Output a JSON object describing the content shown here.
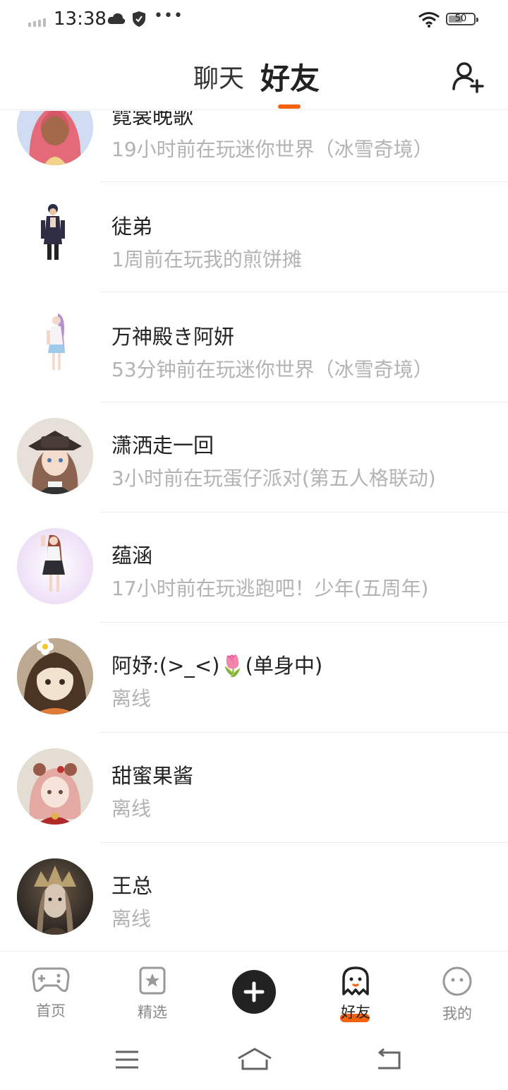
{
  "status_bar": {
    "time": "13:38",
    "battery": "50"
  },
  "header": {
    "tabs": [
      "聊天",
      "好友"
    ],
    "active_tab": "好友"
  },
  "friends": [
    {
      "name": "霓裳晚歌",
      "status": "19小时前在玩迷你世界（冰雪奇境）"
    },
    {
      "name": "徒弟",
      "status": "1周前在玩我的煎饼摊"
    },
    {
      "name": "万神殿き阿妍",
      "status": "53分钟前在玩迷你世界（冰雪奇境）"
    },
    {
      "name": "潇洒走一回",
      "status": "3小时前在玩蛋仔派对(第五人格联动)"
    },
    {
      "name": "蕴涵",
      "status": "17小时前在玩逃跑吧！少年(五周年)"
    },
    {
      "name": "阿妤:(>_<)🌷(单身中)",
      "status": "离线"
    },
    {
      "name": "甜蜜果酱",
      "status": "离线"
    },
    {
      "name": "王总",
      "status": "离线"
    }
  ],
  "nav": {
    "home": "首页",
    "featured": "精选",
    "friends": "好友",
    "mine": "我的"
  },
  "colors": {
    "accent": "#f5620f",
    "text": "#222222",
    "secondary": "#b3b3b3"
  }
}
